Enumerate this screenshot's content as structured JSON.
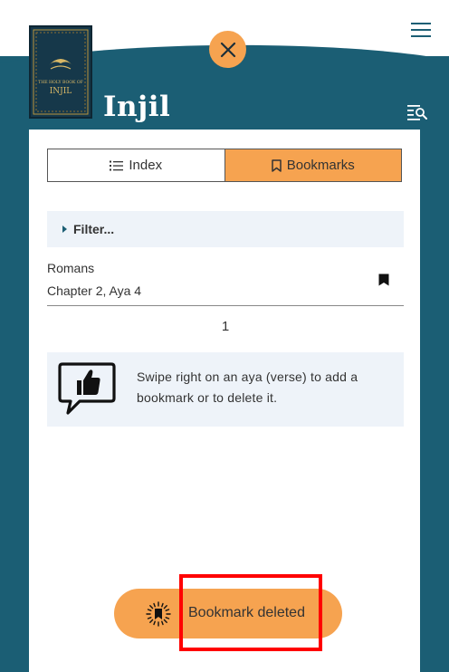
{
  "app": {
    "title": "Injil"
  },
  "book_cover": {
    "line1": "THE HOLY BOOK OF",
    "line2": "INJIL"
  },
  "tabs": [
    {
      "label": "Index",
      "active": false
    },
    {
      "label": "Bookmarks",
      "active": true
    }
  ],
  "filter": {
    "label": "Filter..."
  },
  "bookmarks": [
    {
      "book": "Romans",
      "reference": "Chapter 2, Aya 4"
    }
  ],
  "pagination": {
    "page": "1"
  },
  "hint": {
    "text": "Swipe right on an aya (verse) to add a bookmark or to delete it."
  },
  "toast": {
    "message": "Bookmark deleted"
  },
  "colors": {
    "teal": "#1b5e74",
    "accent": "#f6a350",
    "panel_light": "#eef3f9",
    "highlight": "#ff0000"
  },
  "icons": [
    "close-icon",
    "menu-icon",
    "search-list-icon",
    "list-icon",
    "bookmark-outline-icon",
    "bookmark-icon",
    "thumbs-up-chat-icon",
    "bookmark-burst-icon"
  ]
}
